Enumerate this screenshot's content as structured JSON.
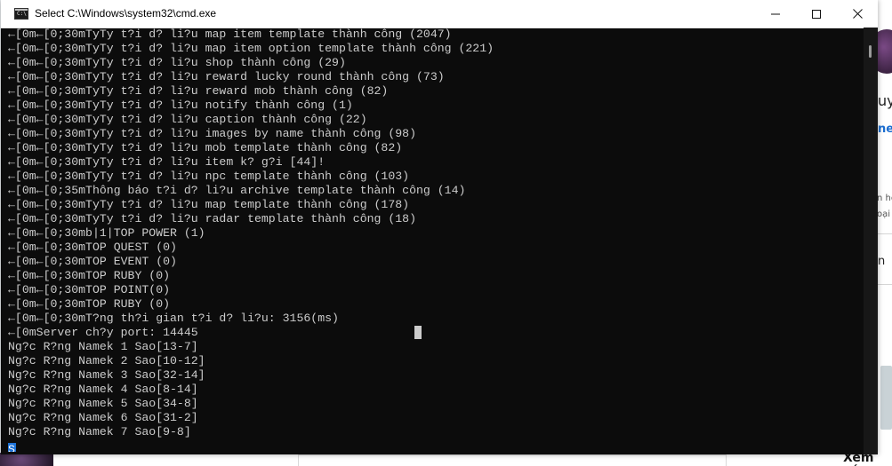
{
  "window": {
    "title": "Select C:\\Windows\\system32\\cmd.exe",
    "icon": "cmd-icon",
    "controls": {
      "minimize": "minimize-icon",
      "maximize": "maximize-icon",
      "close": "close-icon"
    }
  },
  "console": {
    "lines": [
      "←[0m←[0;30mTyTy t?i d? li?u map item template thành công (2047)",
      "←[0m←[0;30mTyTy t?i d? li?u map item option template thành công (221)",
      "←[0m←[0;30mTyTy t?i d? li?u shop thành công (29)",
      "←[0m←[0;30mTyTy t?i d? li?u reward lucky round thành công (73)",
      "←[0m←[0;30mTyTy t?i d? li?u reward mob thành công (82)",
      "←[0m←[0;30mTyTy t?i d? li?u notify thành công (1)",
      "←[0m←[0;30mTyTy t?i d? li?u caption thành công (22)",
      "←[0m←[0;30mTyTy t?i d? li?u images by name thành công (98)",
      "←[0m←[0;30mTyTy t?i d? li?u mob template thành công (82)",
      "←[0m←[0;30mTyTy t?i d? li?u item k? g?i [44]!",
      "←[0m←[0;30mTyTy t?i d? li?u npc template thành công (103)",
      "←[0m←[0;35mThông báo t?i d? li?u archive template thành công (14)",
      "←[0m←[0;30mTyTy t?i d? li?u map template thành công (178)",
      "←[0m←[0;30mTyTy t?i d? li?u radar template thành công (18)",
      "←[0m←[0;30mb|1|TOP POWER (1)",
      "←[0m←[0;30mTOP QUEST (0)",
      "←[0m←[0;30mTOP EVENT (0)",
      "←[0m←[0;30mTOP RUBY (0)",
      "←[0m←[0;30mTOP POINT(0)",
      "←[0m←[0;30mTOP RUBY (0)",
      "←[0m←[0;30mT?ng th?i gian t?i d? li?u: 3156(ms)",
      "←[0mServer ch?y port: 14445",
      "Ng?c R?ng Namek 1 Sao[13-7]",
      "Ng?c R?ng Namek 2 Sao[10-12]",
      "Ng?c R?ng Namek 3 Sao[32-14]",
      "Ng?c R?ng Namek 4 Sao[8-14]",
      "Ng?c R?ng Namek 5 Sao[34-8]",
      "Ng?c R?ng Namek 6 Sao[31-2]",
      "Ng?c R?ng Namek 7 Sao[9-8]"
    ],
    "selection_char": "S",
    "colors": {
      "background": "#0c0c0c",
      "text": "#cccccc",
      "selection": "#1e73d8"
    }
  },
  "background_page": {
    "right_texts": [
      "uyề",
      "nes",
      "n hơ",
      "oại",
      "n"
    ],
    "bottom_right_text": "Xem tất"
  }
}
